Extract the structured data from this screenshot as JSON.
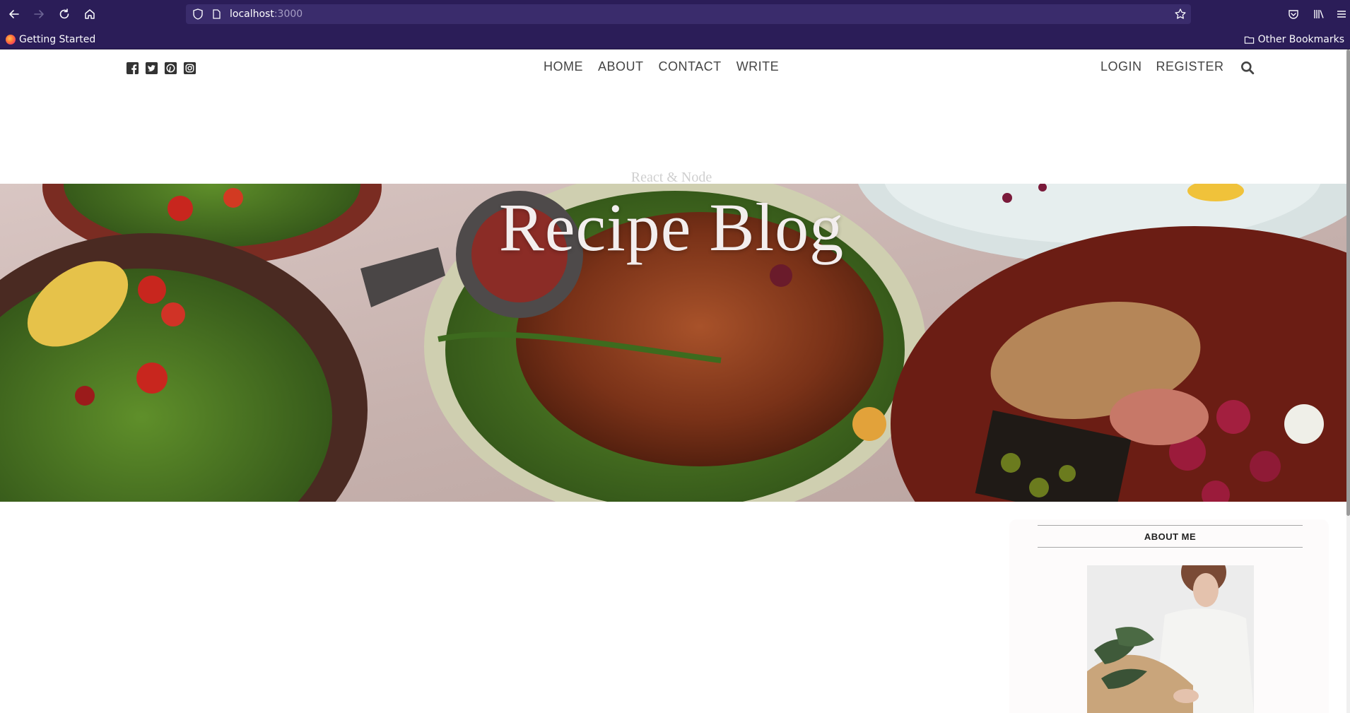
{
  "browser": {
    "url_host": "localhost",
    "url_port": ":3000",
    "bookmarks": {
      "getting_started": "Getting Started",
      "other_bookmarks": "Other Bookmarks"
    },
    "icons": [
      "back-icon",
      "forward-icon",
      "reload-icon",
      "home-icon",
      "shield-icon",
      "page-icon",
      "star-icon",
      "pocket-icon",
      "library-icon",
      "menu-icon",
      "folder-icon"
    ]
  },
  "site": {
    "social_icons": [
      "facebook-icon",
      "twitter-icon",
      "pinterest-icon",
      "instagram-icon"
    ],
    "menu": {
      "home": "HOME",
      "about": "ABOUT",
      "contact": "CONTACT",
      "write": "WRITE"
    },
    "auth": {
      "login": "LOGIN",
      "register": "REGISTER"
    },
    "header": {
      "subtitle": "React & Node",
      "title": "Recipe Blog"
    },
    "sidebar": {
      "title": "ABOUT ME"
    }
  },
  "colors": {
    "browser_chrome": "#2b1d58",
    "urlbar": "#3a2c6c",
    "menu_text": "#444444",
    "title_text": "#f3eeee"
  }
}
